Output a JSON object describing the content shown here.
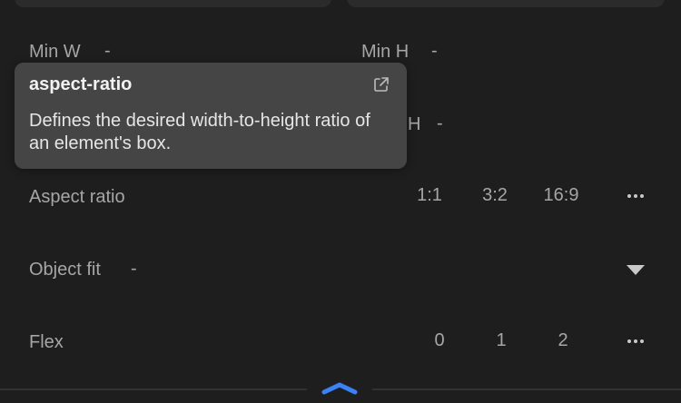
{
  "constraints": {
    "min_w_label": "Min W",
    "min_w_value": "-",
    "min_h_label": "Min H",
    "min_h_value": "-",
    "max_h_partial": "H",
    "max_h_value": "-"
  },
  "aspect_ratio": {
    "label": "Aspect ratio",
    "options": [
      "1:1",
      "3:2",
      "16:9"
    ],
    "more_icon": "ellipsis-icon"
  },
  "object_fit": {
    "label": "Object fit",
    "value": "-",
    "dropdown_icon": "caret-down-icon"
  },
  "flex": {
    "label": "Flex",
    "options": [
      "0",
      "1",
      "2"
    ],
    "more_icon": "ellipsis-icon"
  },
  "tooltip": {
    "title": "aspect-ratio",
    "description": "Defines the desired width-to-height ratio of an element's box.",
    "link_icon": "external-link-icon"
  },
  "footer": {
    "collapse_icon": "chevron-up-icon"
  },
  "colors": {
    "background": "#1e1e1f",
    "tooltip": "#454546",
    "accent": "#3b82f6",
    "text": "#a6a6a6"
  }
}
